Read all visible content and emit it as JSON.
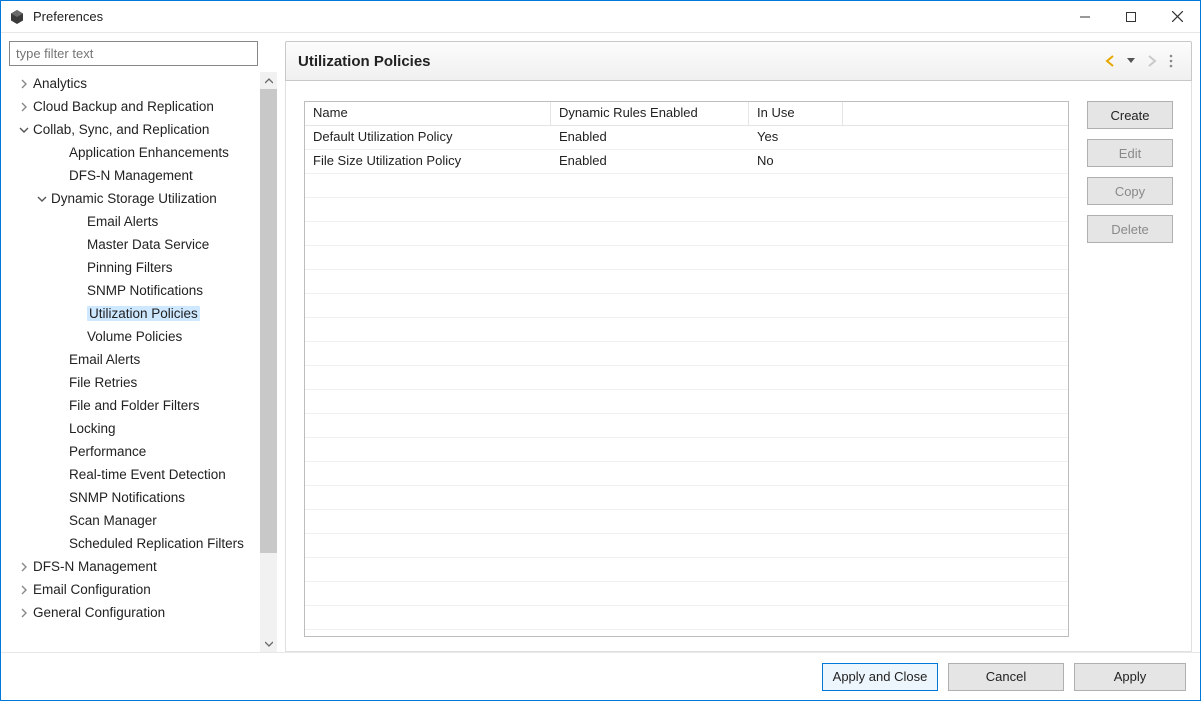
{
  "window": {
    "title": "Preferences"
  },
  "sidebar": {
    "filter_placeholder": "type filter text",
    "items": [
      {
        "label": "Analytics",
        "indent": 0,
        "arrow": "closed"
      },
      {
        "label": "Cloud Backup and Replication",
        "indent": 0,
        "arrow": "closed"
      },
      {
        "label": "Collab, Sync, and Replication",
        "indent": 0,
        "arrow": "open"
      },
      {
        "label": "Application Enhancements",
        "indent": 1,
        "arrow": "none"
      },
      {
        "label": "DFS-N Management",
        "indent": 1,
        "arrow": "none"
      },
      {
        "label": "Dynamic Storage Utilization",
        "indent": 1,
        "arrow": "open"
      },
      {
        "label": "Email Alerts",
        "indent": 2,
        "arrow": "none"
      },
      {
        "label": "Master Data Service",
        "indent": 2,
        "arrow": "none"
      },
      {
        "label": "Pinning Filters",
        "indent": 2,
        "arrow": "none"
      },
      {
        "label": "SNMP Notifications",
        "indent": 2,
        "arrow": "none"
      },
      {
        "label": "Utilization Policies",
        "indent": 2,
        "arrow": "none",
        "selected": true
      },
      {
        "label": "Volume Policies",
        "indent": 2,
        "arrow": "none"
      },
      {
        "label": "Email Alerts",
        "indent": 1,
        "arrow": "none"
      },
      {
        "label": "File Retries",
        "indent": 1,
        "arrow": "none"
      },
      {
        "label": "File and Folder Filters",
        "indent": 1,
        "arrow": "none"
      },
      {
        "label": "Locking",
        "indent": 1,
        "arrow": "none"
      },
      {
        "label": "Performance",
        "indent": 1,
        "arrow": "none"
      },
      {
        "label": "Real-time Event Detection",
        "indent": 1,
        "arrow": "none"
      },
      {
        "label": "SNMP Notifications",
        "indent": 1,
        "arrow": "none"
      },
      {
        "label": "Scan Manager",
        "indent": 1,
        "arrow": "none"
      },
      {
        "label": "Scheduled Replication Filters",
        "indent": 1,
        "arrow": "none"
      },
      {
        "label": "DFS-N Management",
        "indent": 0,
        "arrow": "closed"
      },
      {
        "label": "Email Configuration",
        "indent": 0,
        "arrow": "closed"
      },
      {
        "label": "General Configuration",
        "indent": 0,
        "arrow": "closed"
      }
    ]
  },
  "main": {
    "title": "Utilization Policies",
    "columns": {
      "name": "Name",
      "dynamic": "Dynamic Rules Enabled",
      "in_use": "In Use"
    },
    "rows": [
      {
        "name": "Default Utilization Policy",
        "dynamic": "Enabled",
        "in_use": "Yes"
      },
      {
        "name": "File Size Utilization Policy",
        "dynamic": "Enabled",
        "in_use": "No"
      }
    ],
    "buttons": {
      "create": "Create",
      "edit": "Edit",
      "copy": "Copy",
      "delete": "Delete"
    }
  },
  "footer": {
    "apply_close": "Apply and Close",
    "cancel": "Cancel",
    "apply": "Apply"
  }
}
